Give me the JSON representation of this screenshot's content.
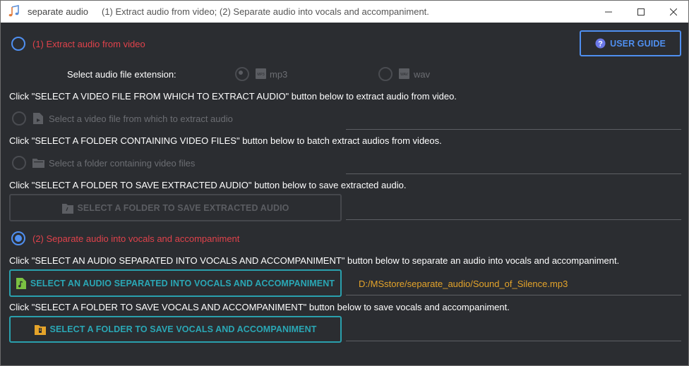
{
  "titlebar": {
    "app_name": "separate audio",
    "subtitle": "(1) Extract audio from video; (2) Separate audio into vocals and accompaniment."
  },
  "section1": {
    "label": "(1) Extract audio from video",
    "selected": false,
    "ext_label": "Select audio file extension:",
    "ext_options": [
      {
        "label": "mp3",
        "icon": "mp3-file-icon",
        "selected": true
      },
      {
        "label": "wav",
        "icon": "wav-file-icon",
        "selected": false
      }
    ],
    "hint_video": "Click \"SELECT A VIDEO FILE FROM WHICH TO EXTRACT AUDIO\" button below to extract audio from video.",
    "option_video_file": "Select a video file from which to extract audio",
    "hint_folder": "Click \"SELECT A FOLDER CONTAINING VIDEO FILES\" button below to batch extract audios from videos.",
    "option_video_folder": "Select a folder containing video files",
    "hint_save": "Click \"SELECT A FOLDER TO SAVE EXTRACTED AUDIO\" button below to save extracted audio.",
    "save_button": "SELECT A FOLDER TO SAVE EXTRACTED AUDIO"
  },
  "user_guide_button": "USER GUIDE",
  "section2": {
    "label": "(2) Separate audio into vocals and accompaniment",
    "selected": true,
    "hint_audio": "Click \"SELECT AN AUDIO SEPARATED INTO VOCALS AND ACCOMPANIMENT\" button below to separate an audio into vocals and accompaniment.",
    "audio_button": "SELECT AN AUDIO SEPARATED INTO VOCALS AND ACCOMPANIMENT",
    "audio_path": "D:/MSstore/separate_audio/Sound_of_Silence.mp3",
    "hint_save": "Click \"SELECT A FOLDER TO SAVE VOCALS AND ACCOMPANIMENT\" button below to save vocals and accompaniment.",
    "save_button": "SELECT A FOLDER TO SAVE VOCALS AND ACCOMPANIMENT"
  },
  "colors": {
    "background": "#2b2d31",
    "accent_blue": "#4f8ff0",
    "accent_teal": "#2aa7b5",
    "label_red": "#e0424b",
    "path_orange": "#e5a42a"
  }
}
